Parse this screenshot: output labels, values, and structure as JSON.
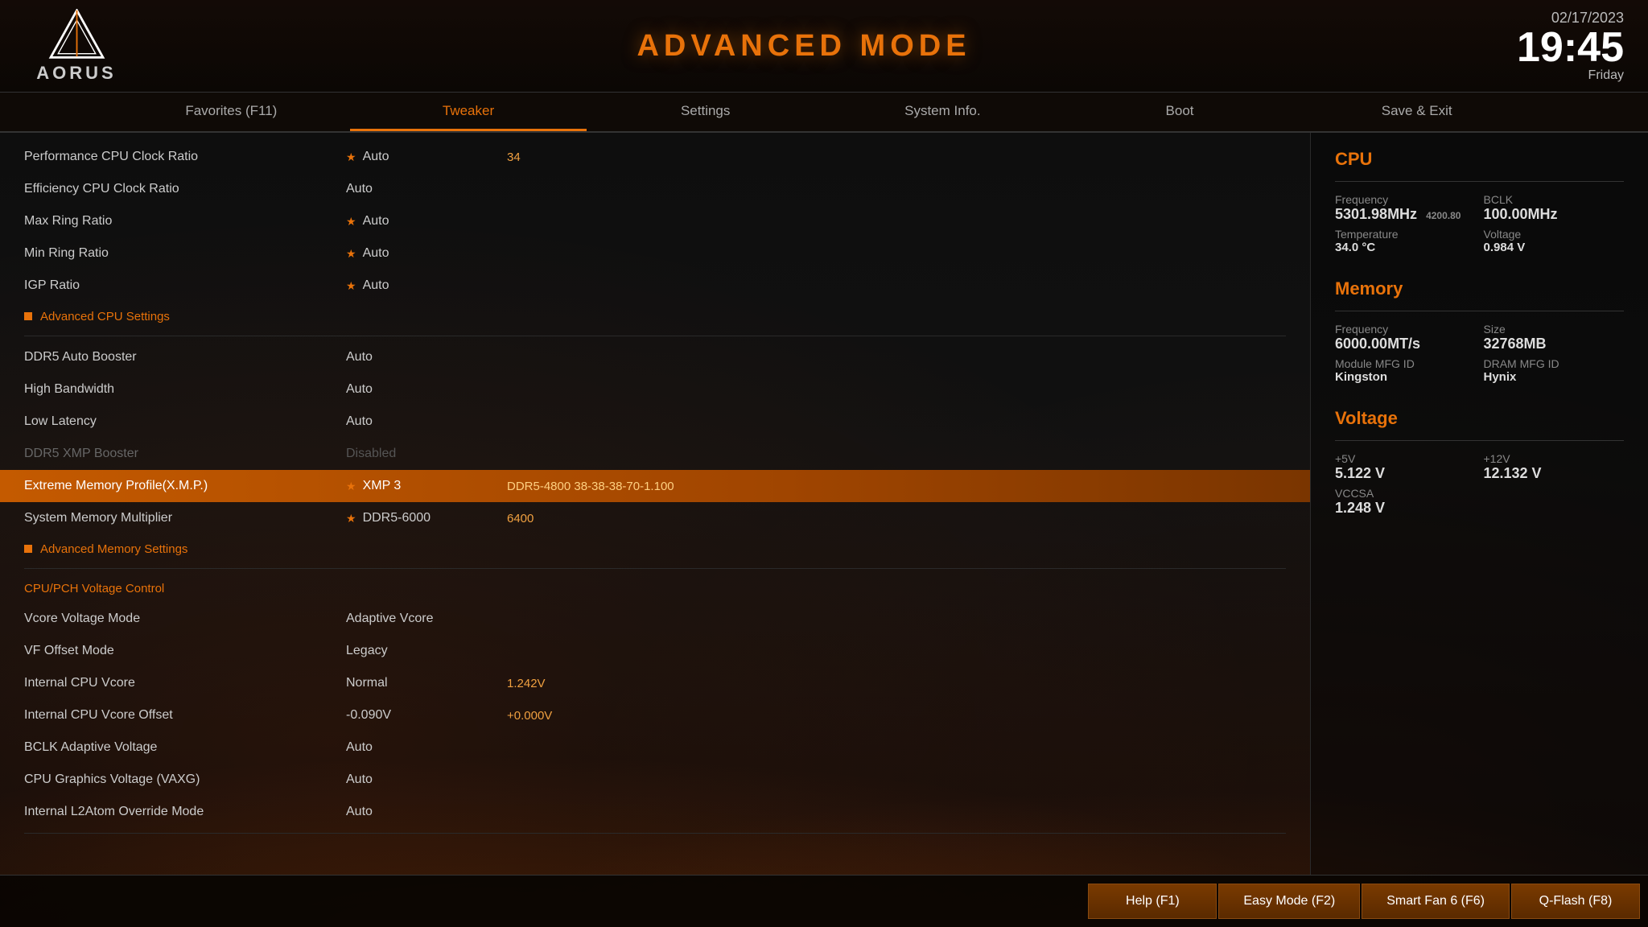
{
  "header": {
    "title": "ADVANCED MODE",
    "date": "02/17/2023",
    "day": "Friday",
    "time": "19:45"
  },
  "nav": {
    "tabs": [
      {
        "id": "favorites",
        "label": "Favorites (F11)",
        "active": false
      },
      {
        "id": "tweaker",
        "label": "Tweaker",
        "active": true
      },
      {
        "id": "settings",
        "label": "Settings",
        "active": false
      },
      {
        "id": "sysinfo",
        "label": "System Info.",
        "active": false
      },
      {
        "id": "boot",
        "label": "Boot",
        "active": false
      },
      {
        "id": "saveexit",
        "label": "Save & Exit",
        "active": false
      }
    ]
  },
  "settings": {
    "rows": [
      {
        "type": "setting",
        "label": "Performance CPU Clock Ratio",
        "value1": "Auto",
        "value2": "34",
        "starred": true,
        "dimmed": false
      },
      {
        "type": "setting",
        "label": "Efficiency CPU Clock Ratio",
        "value1": "Auto",
        "value2": "",
        "starred": false,
        "dimmed": false
      },
      {
        "type": "setting",
        "label": "Max Ring Ratio",
        "value1": "Auto",
        "value2": "",
        "starred": true,
        "dimmed": false
      },
      {
        "type": "setting",
        "label": "Min Ring Ratio",
        "value1": "Auto",
        "value2": "",
        "starred": true,
        "dimmed": false
      },
      {
        "type": "setting",
        "label": "IGP Ratio",
        "value1": "Auto",
        "value2": "",
        "starred": true,
        "dimmed": false
      },
      {
        "type": "section",
        "label": "Advanced CPU Settings"
      },
      {
        "type": "divider"
      },
      {
        "type": "setting",
        "label": "DDR5 Auto Booster",
        "value1": "Auto",
        "value2": "",
        "starred": false,
        "dimmed": false
      },
      {
        "type": "setting",
        "label": "High Bandwidth",
        "value1": "Auto",
        "value2": "",
        "starred": false,
        "dimmed": false
      },
      {
        "type": "setting",
        "label": "Low Latency",
        "value1": "Auto",
        "value2": "",
        "starred": false,
        "dimmed": false
      },
      {
        "type": "setting",
        "label": "DDR5 XMP Booster",
        "value1": "Disabled",
        "value2": "",
        "starred": false,
        "dimmed": true
      },
      {
        "type": "highlight",
        "label": "Extreme Memory Profile(X.M.P.)",
        "value1": "XMP 3",
        "value2": "DDR5-4800 38-38-38-70-1.100",
        "starred": true
      },
      {
        "type": "setting",
        "label": "System Memory Multiplier",
        "value1": "DDR5-6000",
        "value2": "6400",
        "starred": true,
        "dimmed": false
      },
      {
        "type": "section",
        "label": "Advanced Memory Settings"
      },
      {
        "type": "divider"
      },
      {
        "type": "section-cpu",
        "label": "CPU/PCH Voltage Control"
      },
      {
        "type": "setting",
        "label": "Vcore Voltage Mode",
        "value1": "Adaptive Vcore",
        "value2": "",
        "starred": false,
        "dimmed": false
      },
      {
        "type": "setting",
        "label": "VF Offset Mode",
        "value1": "Legacy",
        "value2": "",
        "starred": false,
        "dimmed": false
      },
      {
        "type": "setting",
        "label": "Internal CPU Vcore",
        "value1": "Normal",
        "value2": "1.242V",
        "starred": false,
        "dimmed": false
      },
      {
        "type": "setting",
        "label": "Internal CPU Vcore Offset",
        "value1": "-0.090V",
        "value2": "+0.000V",
        "starred": false,
        "dimmed": false
      },
      {
        "type": "setting",
        "label": "BCLK Adaptive Voltage",
        "value1": "Auto",
        "value2": "",
        "starred": false,
        "dimmed": false
      },
      {
        "type": "setting",
        "label": "CPU Graphics Voltage (VAXG)",
        "value1": "Auto",
        "value2": "",
        "starred": false,
        "dimmed": false
      },
      {
        "type": "setting",
        "label": "Internal L2Atom Override Mode",
        "value1": "Auto",
        "value2": "",
        "starred": false,
        "dimmed": false
      }
    ]
  },
  "cpu_info": {
    "title": "CPU",
    "freq_label": "Frequency",
    "freq_value": "5301.98MHz",
    "freq_sub": "4200.80",
    "bclk_label": "BCLK",
    "bclk_value": "100.00MHz",
    "temp_label": "Temperature",
    "temp_value": "34.0 °C",
    "volt_label": "Voltage",
    "volt_value": "0.984 V"
  },
  "memory_info": {
    "title": "Memory",
    "freq_label": "Frequency",
    "freq_value": "6000.00MT/s",
    "size_label": "Size",
    "size_value": "32768MB",
    "module_label": "Module MFG ID",
    "module_value": "Kingston",
    "dram_label": "DRAM MFG ID",
    "dram_value": "Hynix"
  },
  "voltage_info": {
    "title": "Voltage",
    "v5_label": "+5V",
    "v5_value": "5.122 V",
    "v12_label": "+12V",
    "v12_value": "12.132 V",
    "vccsa_label": "VCCSA",
    "vccsa_value": "1.248 V"
  },
  "toolbar": {
    "buttons": [
      {
        "id": "help",
        "label": "Help (F1)"
      },
      {
        "id": "easymode",
        "label": "Easy Mode (F2)"
      },
      {
        "id": "smartfan",
        "label": "Smart Fan 6 (F6)"
      },
      {
        "id": "qflash",
        "label": "Q-Flash (F8)"
      }
    ]
  }
}
